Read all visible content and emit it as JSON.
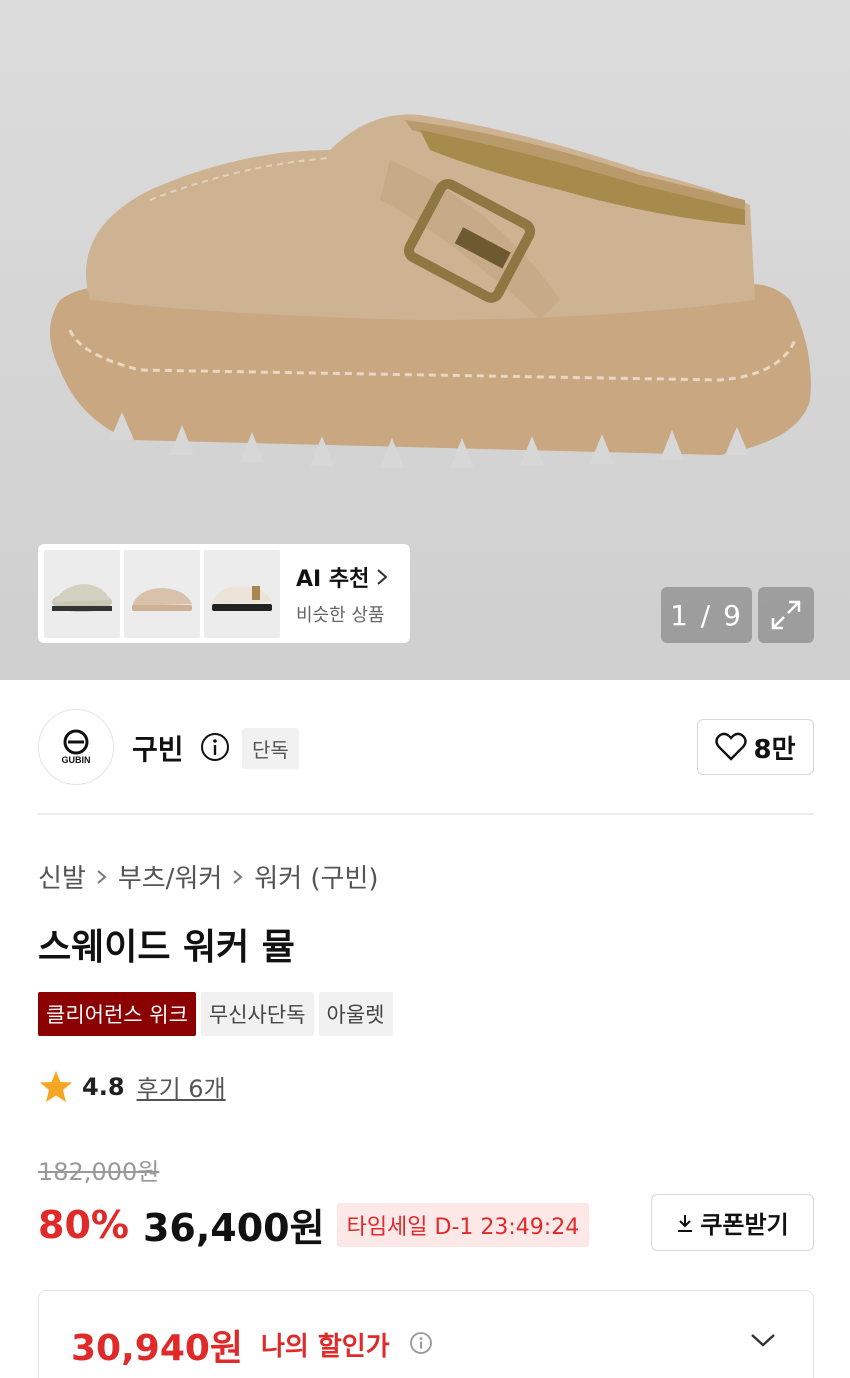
{
  "gallery": {
    "pager": "1 / 9",
    "ai_recommend": {
      "title": "AI 추천",
      "subtitle": "비슷한 상품"
    }
  },
  "brand": {
    "name": "구빈",
    "logo_text": "GUBIN",
    "tag": "단독",
    "likes": "8만"
  },
  "breadcrumb": [
    "신발",
    "부츠/워커",
    "워커 (구빈)"
  ],
  "product": {
    "title": "스웨이드 워커 뮬",
    "badges": [
      "클리어런스 위크",
      "무신사단독",
      "아울렛"
    ],
    "rating": "4.8",
    "reviews": "후기 6개",
    "original_price": "182,000원",
    "discount": "80%",
    "price": "36,400원",
    "time_sale": "타임세일 D-1 23:49:24",
    "coupon_label": "쿠폰받기",
    "my_price": "30,940원",
    "my_price_label": "나의 할인가"
  },
  "colors": {
    "accent_red": "#e02a2a",
    "badge_dark_red": "#8b0000",
    "star": "#f5a623"
  }
}
